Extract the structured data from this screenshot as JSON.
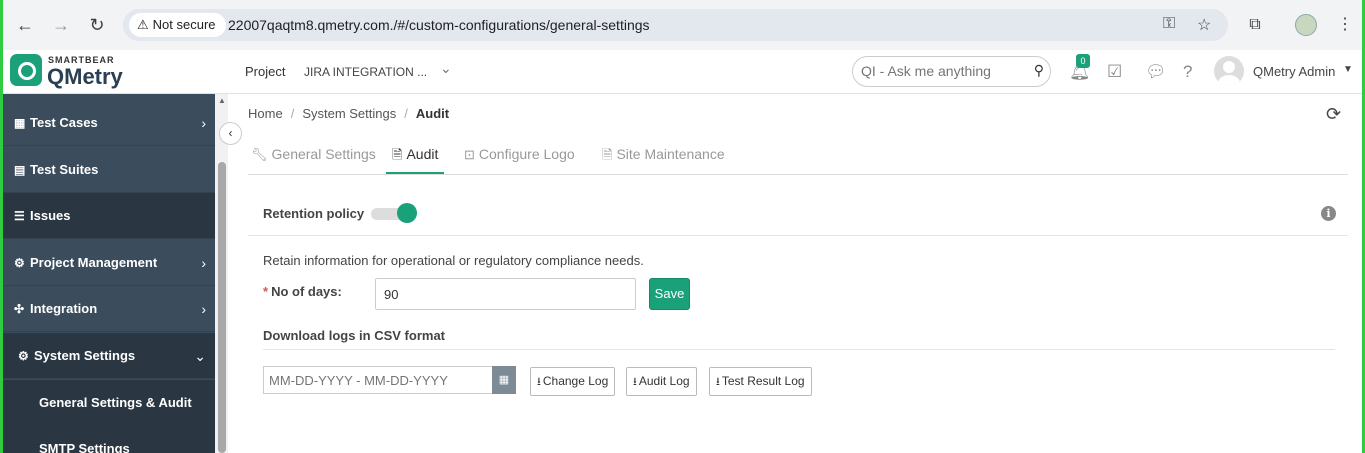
{
  "browser": {
    "not_secure": "Not secure",
    "url": "22007qaqtm8.qmetry.com./#/custom-configurations/general-settings"
  },
  "header": {
    "logo_small": "SMARTBEAR",
    "logo_big": "QMetry",
    "project_label": "Project",
    "project_value": "JIRA INTEGRATION ...",
    "search_placeholder": "QI - Ask me anything",
    "notification_count": "0",
    "user_name": "QMetry Admin"
  },
  "sidebar": {
    "items": [
      {
        "label": "Test Cases",
        "icon": "grid-icon"
      },
      {
        "label": "Test Suites",
        "icon": "suite-icon"
      },
      {
        "label": "Issues",
        "icon": "list-icon"
      },
      {
        "label": "Project Management",
        "icon": "cogs-icon"
      },
      {
        "label": "Integration",
        "icon": "puzzle-icon"
      },
      {
        "label": "System Settings",
        "icon": "gear-icon"
      }
    ],
    "subitems": [
      {
        "label": "General Settings & Audit"
      },
      {
        "label": "SMTP Settings"
      }
    ]
  },
  "breadcrumb": {
    "home": "Home",
    "system_settings": "System Settings",
    "current": "Audit"
  },
  "tabs": [
    {
      "label": "General Settings",
      "icon": "wrench-icon"
    },
    {
      "label": "Audit",
      "icon": "file-icon"
    },
    {
      "label": "Configure Logo",
      "icon": "image-edit-icon"
    },
    {
      "label": "Site Maintenance",
      "icon": "file-icon"
    }
  ],
  "audit": {
    "retention_label": "Retention policy",
    "retention_enabled": true,
    "retain_text": "Retain information for operational or regulatory compliance needs.",
    "required_marker": "*",
    "days_label": "No of days:",
    "days_value": "90",
    "save_label": "Save",
    "download_title": "Download logs in CSV format",
    "date_placeholder": "MM-DD-YYYY - MM-DD-YYYY",
    "buttons": {
      "change_log": "Change Log",
      "audit_log": "Audit Log",
      "test_result_log": "Test Result Log"
    }
  },
  "colors": {
    "accent": "#1aa179",
    "sidebar": "#3b4c5c",
    "sidebar_active": "#2a3642"
  }
}
